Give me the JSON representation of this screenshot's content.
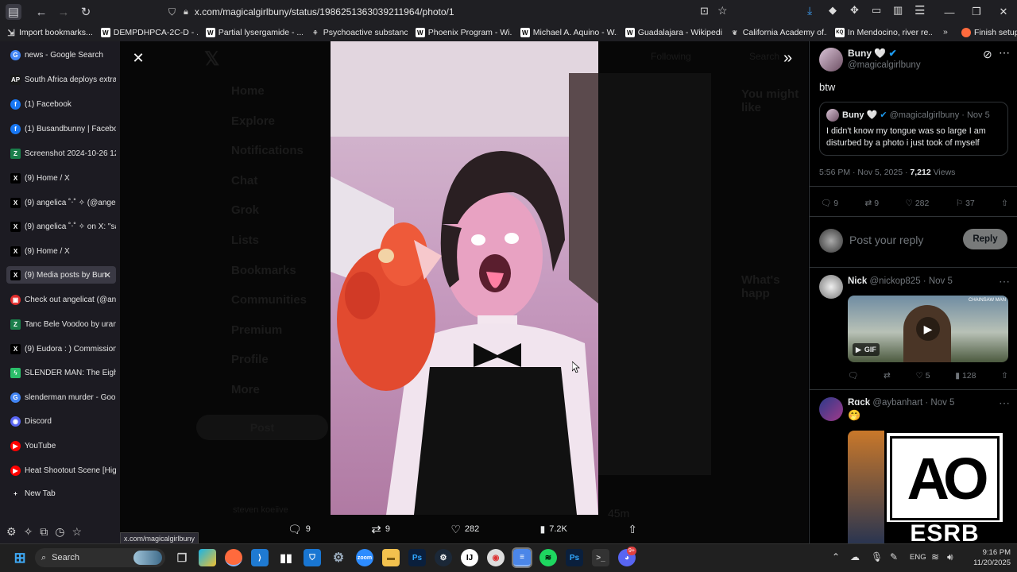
{
  "browser": {
    "url": "x.com/magicalgirlbuny/status/1986251363039211964/photo/1",
    "status_link": "x.com/magicalgirlbuny",
    "bookmarks": [
      "Import bookmarks...",
      "DEMPDHPCA-2C-D - ...",
      "Partial lysergamide - ...",
      "Psychoactive substanc...",
      "Phoenix Program - Wi...",
      "Michael A. Aquino - W...",
      "Guadalajara - Wikipedia",
      "California Academy of...",
      "In Mendocino, river re...",
      "Finish setup"
    ]
  },
  "sidebar": {
    "tabs": [
      {
        "label": "news - Google Search",
        "icon": "G",
        "color": "#4285f4"
      },
      {
        "label": "South Africa deploys extra",
        "icon": "AP",
        "color": "#1a1a1a"
      },
      {
        "label": "(1) Facebook",
        "icon": "f",
        "color": "#1877f2"
      },
      {
        "label": "(1) Busandbunny | Faceboo",
        "icon": "f",
        "color": "#1877f2"
      },
      {
        "label": "Screenshot 2024-10-26 12",
        "icon": "Z",
        "color": "#1a7f4b"
      },
      {
        "label": "(9) Home / X",
        "icon": "X",
        "color": "#000"
      },
      {
        "label": "(9) angelica ˚‧˚ ✧ (@angel",
        "icon": "X",
        "color": "#000"
      },
      {
        "label": "(9) angelica ˚‧˚ ✧ on X: \"sa",
        "icon": "X",
        "color": "#000"
      },
      {
        "label": "(9) Home / X",
        "icon": "X",
        "color": "#000"
      },
      {
        "label": "(9) Media posts by Bun",
        "icon": "X",
        "color": "#000"
      },
      {
        "label": "Check out angelicat (@ang",
        "icon": "▣",
        "color": "#e02c2c"
      },
      {
        "label": "Tanc Bele Voodoo by urani",
        "icon": "Z",
        "color": "#1a7f4b"
      },
      {
        "label": "(9) Eudora : ) Commission",
        "icon": "X",
        "color": "#000"
      },
      {
        "label": "SLENDER MAN: The Eight",
        "icon": "ϟ",
        "color": "#2bbf6a"
      },
      {
        "label": "slenderman murder - Goo",
        "icon": "G",
        "color": "#4285f4"
      },
      {
        "label": "Discord",
        "icon": "◉",
        "color": "#5865f2"
      },
      {
        "label": "YouTube",
        "icon": "▶",
        "color": "#ff0000"
      },
      {
        "label": "Heat Shootout Scene [Hig",
        "icon": "▶",
        "color": "#ff0000"
      },
      {
        "label": "New Tab",
        "icon": "+",
        "color": "#1c1b22"
      }
    ]
  },
  "bg_nav": [
    "Home",
    "Explore",
    "Notifications",
    "Chat",
    "Grok",
    "Lists",
    "Bookmarks",
    "Communities",
    "Premium",
    "Profile",
    "More"
  ],
  "bg_post": "Post",
  "bg_following": "Following",
  "bg_search": "Search",
  "bg_might_like": "You might like",
  "bg_happening": "What's happ",
  "bg_user": "steven koeiive",
  "bg_time": "45m",
  "media_bar": {
    "replies": "9",
    "reposts": "9",
    "likes": "282",
    "views": "7.2K"
  },
  "post": {
    "name": "Buny 🤍",
    "handle": "@magicalgirlbuny",
    "text": "btw",
    "quote": {
      "name": "Buny 🤍",
      "handle": "@magicalgirlbuny",
      "date": "Nov 5",
      "text": "I didn't know my tongue was so large I am disturbed by a photo i just took of myself"
    },
    "timestamp": "5:56 PM · Nov 5, 2025 · ",
    "views_count": "7,212",
    "views_label": " Views",
    "stats": {
      "replies": "9",
      "reposts": "9",
      "likes": "282",
      "bookmarks": "37"
    },
    "reply_placeholder": "Post your reply",
    "reply_button": "Reply"
  },
  "replies": [
    {
      "name": "Nick",
      "handle": "@nickop825",
      "date": "Nov 5",
      "gif_label": "GIF",
      "gif_caption": "CHAINSAW MAN",
      "likes": "5",
      "views": "128"
    },
    {
      "name": "Rɑck",
      "handle": "@aybanhart",
      "date": "Nov 5",
      "emoji": "🤭"
    }
  ],
  "esrb": {
    "rating": "AO",
    "brand": "ESRB"
  },
  "taskbar": {
    "search": "Search",
    "lang": "ENG",
    "time": "9:16 PM",
    "date": "11/20/2025",
    "badge": "9+"
  }
}
